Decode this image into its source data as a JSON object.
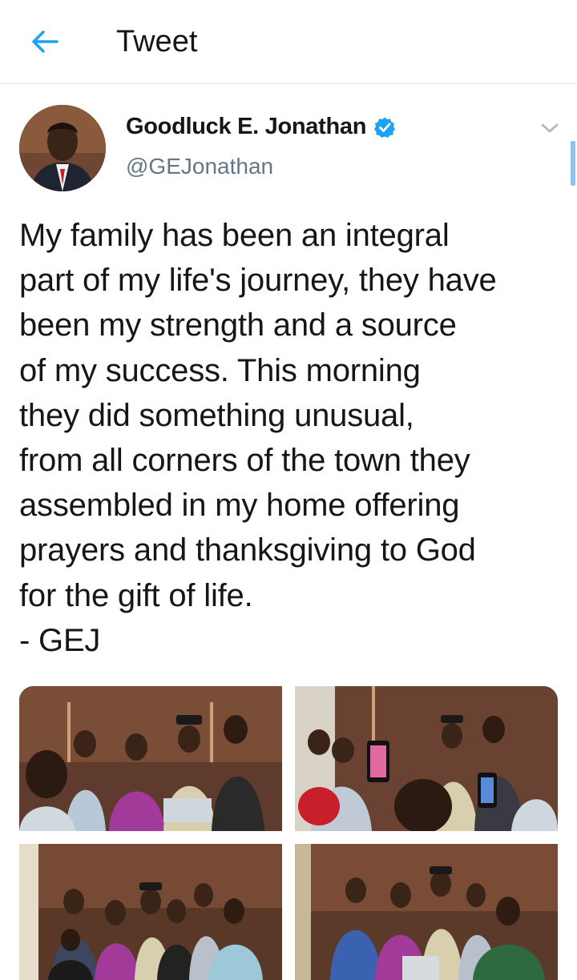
{
  "header": {
    "title": "Tweet",
    "back_icon": "arrow-left-icon",
    "accent_color": "#1da1f2"
  },
  "tweet": {
    "author_name": "Goodluck E. Jonathan",
    "author_handle": "@GEJonathan",
    "verified": true,
    "text": "My family has been an integral\npart of my life's journey, they have\nbeen my strength and a source\nof my success. This morning\nthey did something unusual,\nfrom all corners of the town they\nassembled in my home offering\nprayers and thanksgiving to God\nfor the gift of  life.\n- GEJ",
    "media_count": 4
  }
}
